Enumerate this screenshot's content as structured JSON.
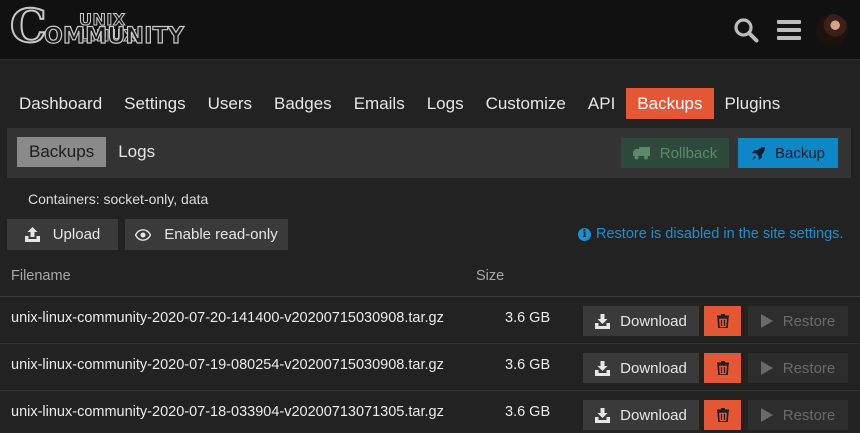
{
  "brand": {
    "line1": "UNIX LINUX",
    "initial": "C",
    "line2": "OMMUNITY"
  },
  "header": {
    "icons": [
      "search-icon",
      "hamburger-menu-icon"
    ],
    "avatar": "user-avatar"
  },
  "admin_nav": {
    "items": [
      {
        "label": "Dashboard",
        "active": false
      },
      {
        "label": "Settings",
        "active": false
      },
      {
        "label": "Users",
        "active": false
      },
      {
        "label": "Badges",
        "active": false
      },
      {
        "label": "Emails",
        "active": false
      },
      {
        "label": "Logs",
        "active": false
      },
      {
        "label": "Customize",
        "active": false
      },
      {
        "label": "API",
        "active": false
      },
      {
        "label": "Backups",
        "active": true
      },
      {
        "label": "Plugins",
        "active": false
      }
    ]
  },
  "subnav": {
    "items": [
      {
        "label": "Backups",
        "active": true
      },
      {
        "label": "Logs",
        "active": false
      }
    ],
    "rollback_label": "Rollback",
    "backup_label": "Backup"
  },
  "toolbar": {
    "containers": "Containers: socket-only, data",
    "upload_label": "Upload",
    "readonly_label": "Enable read-only",
    "restore_note": "Restore is disabled in the site settings."
  },
  "table": {
    "headers": {
      "filename": "Filename",
      "size": "Size"
    },
    "download_label": "Download",
    "restore_label": "Restore",
    "rows": [
      {
        "filename": "unix-linux-community-2020-07-20-141400-v20200715030908.tar.gz",
        "size": "3.6 GB"
      },
      {
        "filename": "unix-linux-community-2020-07-19-080254-v20200715030908.tar.gz",
        "size": "3.6 GB"
      },
      {
        "filename": "unix-linux-community-2020-07-18-033904-v20200713071305.tar.gz",
        "size": "3.6 GB"
      }
    ]
  },
  "colors": {
    "accent": "#e45735",
    "primary_blue": "#0e87c6",
    "info_blue": "#1b8fd0",
    "background": "#222222",
    "header_bg": "#111111"
  }
}
